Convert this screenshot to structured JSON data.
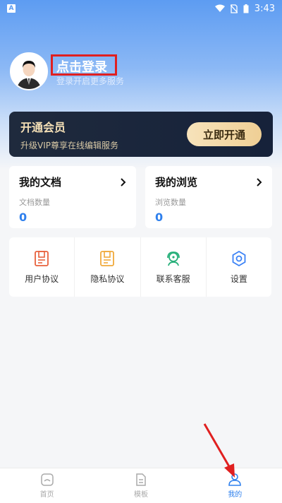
{
  "status_bar": {
    "app_badge": "A",
    "time": "3:43"
  },
  "profile": {
    "login_title": "点击登录",
    "login_subtitle": "登录开启更多服务"
  },
  "vip": {
    "title": "开通会员",
    "subtitle": "升级VIP尊享在线编辑服务",
    "button": "立即开通"
  },
  "stats": [
    {
      "title": "我的文档",
      "label": "文档数量",
      "value": "0"
    },
    {
      "title": "我的浏览",
      "label": "浏览数量",
      "value": "0"
    }
  ],
  "grid": [
    {
      "label": "用户协议",
      "icon": "user-agreement-icon"
    },
    {
      "label": "隐私协议",
      "icon": "privacy-agreement-icon"
    },
    {
      "label": "联系客服",
      "icon": "customer-service-icon"
    },
    {
      "label": "设置",
      "icon": "settings-icon"
    }
  ],
  "nav": [
    {
      "label": "首页",
      "icon": "home-icon"
    },
    {
      "label": "模板",
      "icon": "template-icon"
    },
    {
      "label": "我的",
      "icon": "profile-icon",
      "active": true
    }
  ],
  "colors": {
    "accent": "#2f80ed",
    "annotation": "#e02020",
    "vip_bg": "#1f2a3d",
    "vip_gold": "#f4dfb6"
  }
}
